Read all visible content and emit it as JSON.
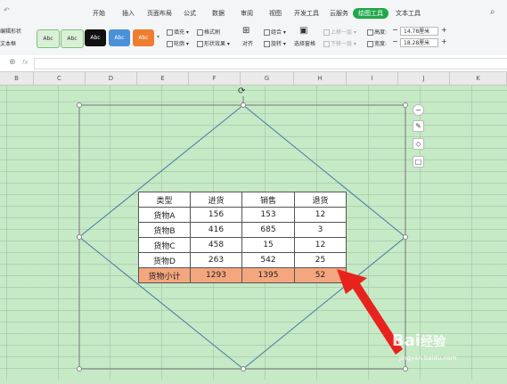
{
  "ribbon": {
    "tabs": [
      {
        "label": "开始",
        "active": false
      },
      {
        "label": "插入",
        "active": false
      },
      {
        "label": "页面布局",
        "active": false
      },
      {
        "label": "公式",
        "active": false
      },
      {
        "label": "数据",
        "active": false
      },
      {
        "label": "审阅",
        "active": false
      },
      {
        "label": "视图",
        "active": false
      },
      {
        "label": "开发工具",
        "active": false
      },
      {
        "label": "云服务",
        "active": false
      },
      {
        "label": "绘图工具",
        "active": true
      },
      {
        "label": "文本工具",
        "active": false
      }
    ],
    "left_items": [
      "编辑形状",
      "文本框"
    ],
    "styles": [
      {
        "label": "Abc",
        "bg": "#d9f0d6",
        "color": "#333",
        "border": "#7fbf7f"
      },
      {
        "label": "Abc",
        "bg": "#d9f0d6",
        "color": "#333",
        "border": "#7fbf7f"
      },
      {
        "label": "Abc",
        "bg": "#111111",
        "color": "#ffffff",
        "border": "#111111"
      },
      {
        "label": "Abc",
        "bg": "#4a90d9",
        "color": "#ffffff",
        "border": "#4a90d9"
      },
      {
        "label": "Abc",
        "bg": "#ed7d31",
        "color": "#ffffff",
        "border": "#ed7d31"
      }
    ],
    "fill_label": "填充",
    "format_brush_label": "格式刷",
    "outline_label": "轮廓",
    "shape_effect_label": "形状效果",
    "align_label": "对齐",
    "group_label": "组合",
    "rotate_label": "旋转",
    "selection_pane_label": "选择窗格",
    "bring_forward_label": "上移一层",
    "send_backward_label": "下移一层",
    "height_label": "高度:",
    "height_value": "14.78厘米",
    "width_label": "宽度:",
    "width_value": "18.28厘米",
    "search_icon": "search-icon"
  },
  "formula_bar": {
    "fx_label": "fx",
    "value": ""
  },
  "columns": [
    "B",
    "C",
    "D",
    "E",
    "F",
    "G",
    "H",
    "I",
    "J",
    "K"
  ],
  "table": {
    "header": [
      "类型",
      "进货",
      "销售",
      "退货"
    ],
    "rows": [
      [
        "货物A",
        "156",
        "153",
        "12"
      ],
      [
        "货物B",
        "416",
        "685",
        "3"
      ],
      [
        "货物C",
        "458",
        "15",
        "12"
      ],
      [
        "货物D",
        "263",
        "542",
        "25"
      ]
    ],
    "total": [
      "货物小计",
      "1293",
      "1395",
      "52"
    ],
    "total_color": "#f4a67e"
  },
  "watermark": {
    "brand": "Bai",
    "brand2": "经验",
    "url": "jingyan.baidu.com"
  },
  "colors": {
    "accent": "#20a84a",
    "arrow": "#e8231e",
    "sheet_bg": "#c6e9c6"
  }
}
